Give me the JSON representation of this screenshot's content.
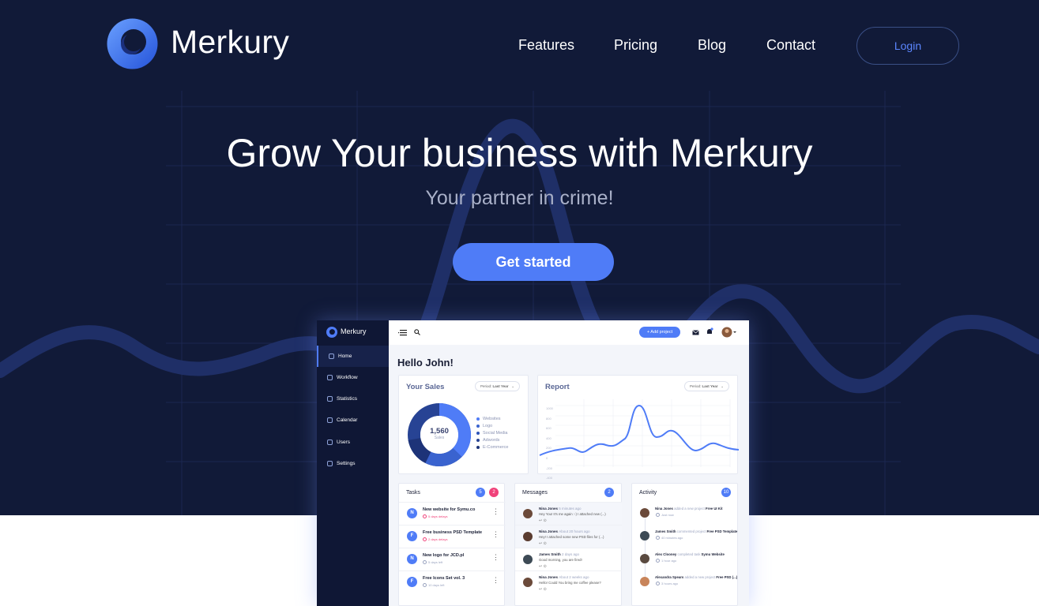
{
  "header": {
    "brand": "Merkury",
    "nav": [
      "Features",
      "Pricing",
      "Blog",
      "Contact"
    ],
    "login_label": "Login"
  },
  "hero": {
    "title": "Grow Your business with Merkury",
    "subtitle": "Your partner in crime!",
    "cta_label": "Get started"
  },
  "colors": {
    "accent": "#4f7cf7",
    "navy": "#111a38",
    "pink": "#f0427a"
  },
  "mockup": {
    "brand": "Merkury",
    "sidebar": [
      "Home",
      "Workflow",
      "Statistics",
      "Calendar",
      "Users",
      "Settings"
    ],
    "add_project": "+ Add project",
    "greeting": "Hello John!",
    "sales": {
      "title": "Your Sales",
      "period_label": "Period:",
      "period_value": "Last Year",
      "total": "1,560",
      "total_label": "Sales",
      "legend": [
        "Websites",
        "Logo",
        "Social Media",
        "Adwords",
        "E-Commerce"
      ]
    },
    "report": {
      "title": "Report",
      "period_label": "Period:",
      "period_value": "Last Year",
      "yticks": [
        "1000",
        "800",
        "600",
        "400",
        "200",
        "0",
        "-200",
        "-400"
      ]
    },
    "tasks": {
      "title": "Tasks",
      "badge_a": "5",
      "badge_b": "2",
      "items": [
        {
          "initial": "N",
          "title": "New website for Symu.co",
          "sub": "5 days delays"
        },
        {
          "initial": "F",
          "title": "Free business PSD Template",
          "sub": "2 days delays"
        },
        {
          "initial": "N",
          "title": "New logo for JCD.pl",
          "sub": "5 days left"
        },
        {
          "initial": "F",
          "title": "Free Icons Set vol. 3",
          "sub": "10 days left"
        }
      ]
    },
    "messages": {
      "title": "Messages",
      "badge": "2",
      "items": [
        {
          "name": "Nina Jones",
          "time": "5 minutes ago",
          "text": "Hey You! It's me again :-) I attached new (...)"
        },
        {
          "name": "Nina Jones",
          "time": "About 20 hours ago",
          "text": "Hey! I attached some new PSD files for (...)"
        },
        {
          "name": "James Smith",
          "time": "2 days ago",
          "text": "Good morning, you are fired!"
        },
        {
          "name": "Nina Jones",
          "time": "About 2 weeks ago",
          "text": "Hello! Could You bring me coffee please?"
        }
      ]
    },
    "activity": {
      "title": "Activity",
      "badge": "10",
      "items": [
        {
          "name": "Nina Jones",
          "action": "added a new project",
          "target": "Free UI Kit",
          "time": "Just now"
        },
        {
          "name": "James Smith",
          "action": "commented project",
          "target": "Free PSD Template",
          "time": "40 minutes ago"
        },
        {
          "name": "Alex Clooney",
          "action": "completed task",
          "target": "Symu Website",
          "time": "1 hour ago"
        },
        {
          "name": "Alexandra Spears",
          "action": "added a new project",
          "target": "Free PSD (...)",
          "time": "3 hours ago"
        }
      ]
    }
  }
}
